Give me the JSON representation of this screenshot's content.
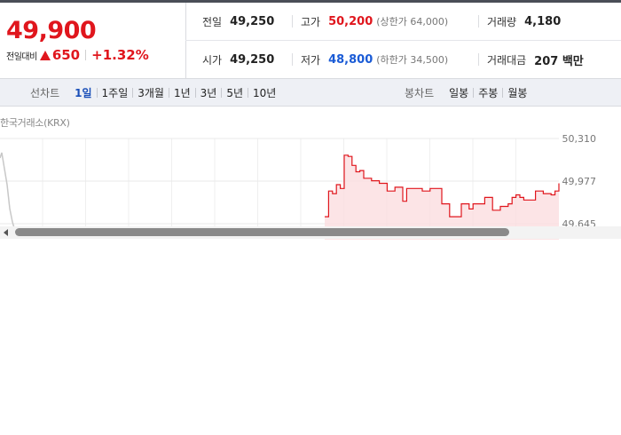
{
  "quote": {
    "price": "49,900",
    "change_label": "전일대비",
    "change_icon": "up-triangle-icon",
    "change_amount": "650",
    "change_rate": "+1.32%",
    "stats": {
      "prev_close": {
        "label": "전일",
        "value": "49,250"
      },
      "high": {
        "label": "고가",
        "value": "50,200",
        "sub": "(상한가 64,000)"
      },
      "volume": {
        "label": "거래량",
        "value": "4,180"
      },
      "open": {
        "label": "시가",
        "value": "49,250"
      },
      "low": {
        "label": "저가",
        "value": "48,800",
        "sub": "(하한가 34,500)"
      },
      "amount": {
        "label": "거래대금",
        "value": "207 백만"
      }
    },
    "colors": {
      "up": "#e0161d",
      "down": "#1a5bd6"
    }
  },
  "tabs": {
    "line_label": "선차트",
    "line_tabs": [
      "1일",
      "1주일",
      "3개월",
      "1년",
      "3년",
      "5년",
      "10년"
    ],
    "active_tab": "1일",
    "candle_label": "봉차트",
    "candle_tabs": [
      "일봉",
      "주봉",
      "월봉"
    ]
  },
  "chart_data": {
    "type": "area",
    "source": "한국거래소(KRX)",
    "y_tick_labels": [
      "50,310",
      "49,977",
      "49,645"
    ],
    "ylim": [
      49645,
      50310
    ],
    "grid": true,
    "series": [
      {
        "color": "#e0161d",
        "x": [
          0,
          1,
          2,
          3,
          4,
          5,
          6,
          7,
          8,
          9,
          10,
          11,
          12,
          13,
          14,
          15,
          16,
          17,
          18,
          19,
          20,
          21,
          22,
          23,
          24,
          25,
          26,
          27,
          28,
          29,
          30,
          31,
          32,
          33,
          34,
          35,
          36,
          37,
          38,
          39,
          40,
          41,
          42,
          43,
          44,
          45,
          46,
          47,
          48,
          49,
          50,
          51,
          52,
          53,
          54,
          55,
          56,
          57,
          58,
          59,
          60
        ],
        "values": [
          49700,
          49900,
          49880,
          49950,
          49920,
          50180,
          50170,
          50100,
          50050,
          50060,
          50000,
          50000,
          49980,
          49980,
          49960,
          49960,
          49900,
          49900,
          49930,
          49930,
          49820,
          49920,
          49920,
          49920,
          49920,
          49900,
          49900,
          49920,
          49920,
          49920,
          49800,
          49800,
          49700,
          49700,
          49700,
          49800,
          49800,
          49760,
          49800,
          49800,
          49800,
          49850,
          49850,
          49750,
          49750,
          49780,
          49780,
          49800,
          49850,
          49870,
          49850,
          49830,
          49830,
          49830,
          49900,
          49900,
          49880,
          49880,
          49870,
          49900,
          49960
        ]
      }
    ]
  }
}
